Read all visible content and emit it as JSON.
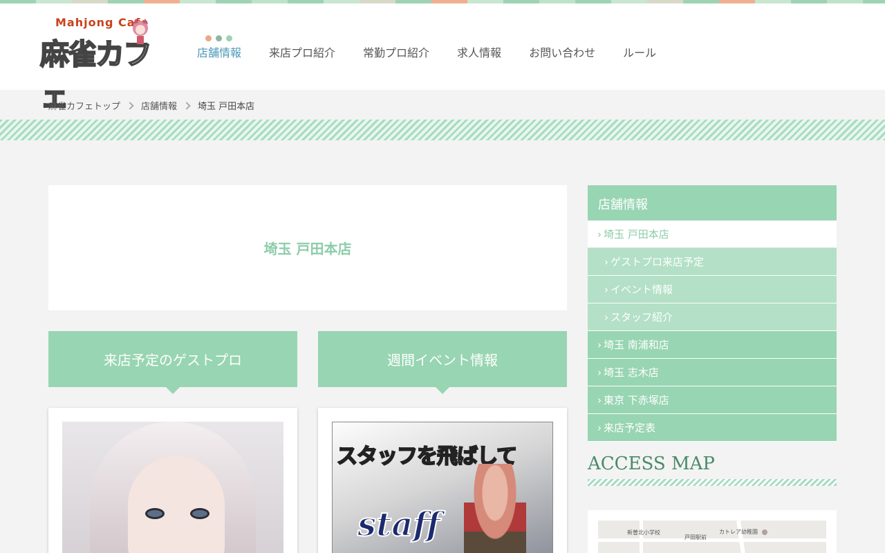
{
  "header": {
    "logo_en": "Mahjong Cafe",
    "logo_jp": "麻雀カフェ",
    "nav": [
      {
        "label": "店舗情報",
        "active": true
      },
      {
        "label": "来店プロ紹介"
      },
      {
        "label": "常勤プロ紹介"
      },
      {
        "label": "求人情報"
      },
      {
        "label": "お問い合わせ"
      },
      {
        "label": "ルール"
      }
    ],
    "dot_colors": [
      "#e8a98a",
      "#8cb8a0",
      "#9ed3b4"
    ]
  },
  "breadcrumb": [
    "麻雀カフェトップ",
    "店舗情報",
    "埼玉 戸田本店"
  ],
  "main": {
    "page_title": "埼玉 戸田本店",
    "sections": [
      {
        "heading": "来店予定のゲストプロ"
      },
      {
        "heading": "週間イベント情報"
      }
    ],
    "event_banner": {
      "headline": "スタッフを飛ばして",
      "word": "staff"
    }
  },
  "sidebar": {
    "title": "店舗情報",
    "items": [
      {
        "label": "埼玉 戸田本店",
        "state": "current"
      },
      {
        "label": "ゲストプロ来店予定",
        "state": "sub"
      },
      {
        "label": "イベント情報",
        "state": "sub"
      },
      {
        "label": "スタッフ紹介",
        "state": "sub"
      },
      {
        "label": "埼玉 南浦和店"
      },
      {
        "label": "埼玉 志木店"
      },
      {
        "label": "東京 下赤塚店"
      },
      {
        "label": "来店予定表"
      }
    ],
    "access_title": "ACCESS MAP"
  },
  "map": {
    "labels": [
      "新曽北小学校",
      "戸田駅前",
      "カトレア幼稚園"
    ]
  },
  "colors": {
    "accent_green": "#98d5b2",
    "nav_active": "#4a98b8",
    "title_green": "#8cccaa"
  }
}
